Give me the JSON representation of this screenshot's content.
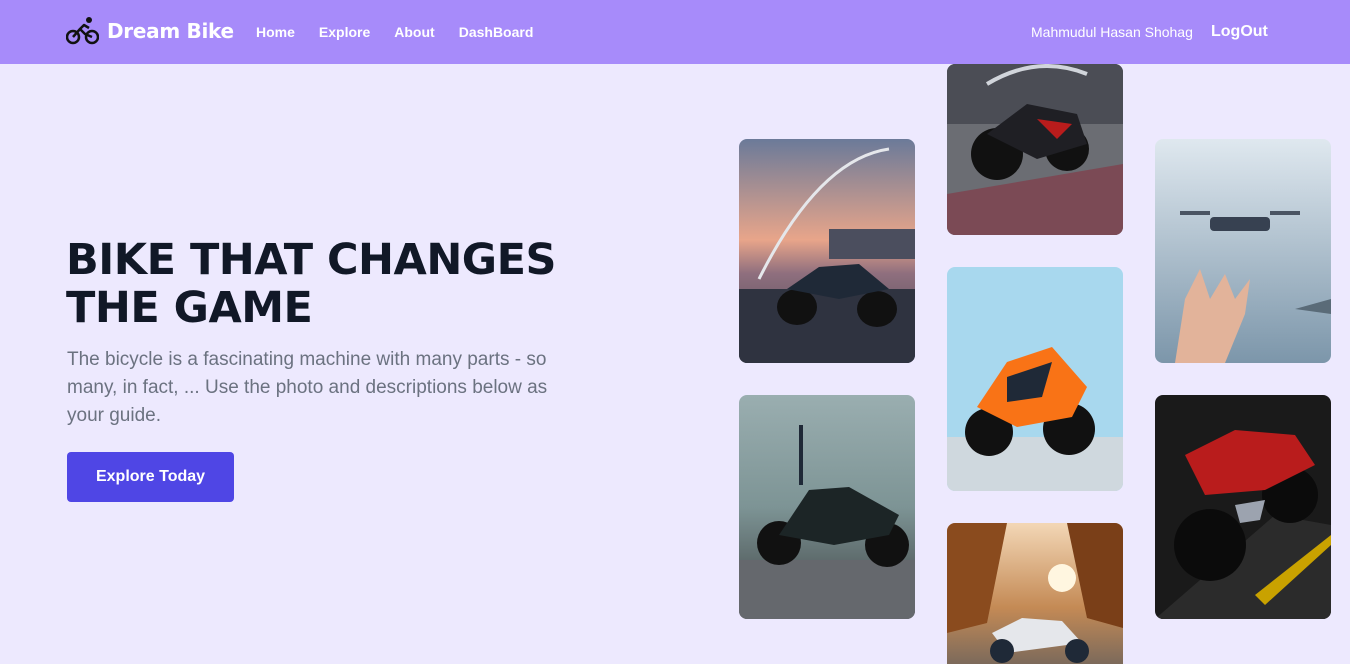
{
  "nav": {
    "brand": "Dream Bike",
    "brand_icon": "bicycle-icon",
    "links": [
      "Home",
      "Explore",
      "About",
      "DashBoard"
    ],
    "user_name": "Mahmudul Hasan Shohag",
    "logout_label": "LogOut"
  },
  "hero": {
    "title": "BIKE THAT CHANGES THE GAME",
    "description": "The bicycle is a fascinating machine with many parts - so many, in fact, ... Use the photo and descriptions below as your guide.",
    "cta_label": "Explore Today"
  },
  "colors": {
    "navbar": "#a78bfa",
    "background": "#ede9fe",
    "cta": "#4f46e5",
    "title": "#111827",
    "body_text": "#6b7280"
  }
}
